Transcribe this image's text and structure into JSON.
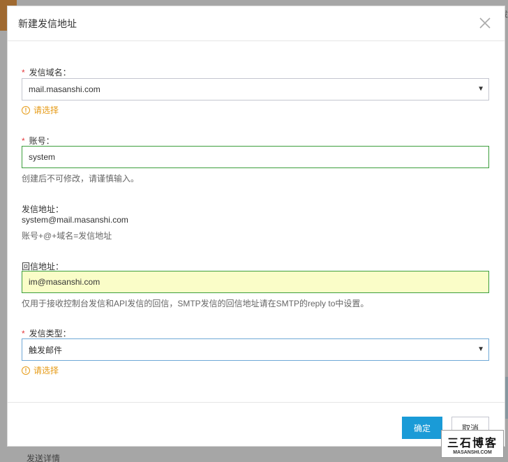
{
  "background": {
    "right_text": "已发",
    "bottom_text": "发送详情"
  },
  "dialog": {
    "title": "新建发信地址",
    "close_icon": "close-icon"
  },
  "form": {
    "domain": {
      "required_mark": "*",
      "label": "发信域名：",
      "value": "mail.masanshi.com",
      "warning": "请选择"
    },
    "account": {
      "required_mark": "*",
      "label": "账号：",
      "value": "system",
      "help": "创建后不可修改，请谨慎输入。"
    },
    "sender_address": {
      "label": "发信地址：",
      "value": "system@mail.masanshi.com",
      "hint": "账号+@+域名=发信地址"
    },
    "reply_address": {
      "label": "回信地址：",
      "value": "im@masanshi.com",
      "help": "仅用于接收控制台发信和API发信的回信，SMTP发信的回信地址请在SMTP的reply to中设置。"
    },
    "send_type": {
      "required_mark": "*",
      "label": "发信类型：",
      "value": "触发邮件",
      "warning": "请选择"
    }
  },
  "footer": {
    "confirm_label": "确定",
    "cancel_label": "取消"
  },
  "watermark": {
    "title": "三石博客",
    "subtitle": "MASANSHI.COM"
  },
  "colors": {
    "primary": "#1a9bd7",
    "warning": "#e69b17",
    "required": "#e4393c",
    "valid_border": "#3c9e3c"
  }
}
